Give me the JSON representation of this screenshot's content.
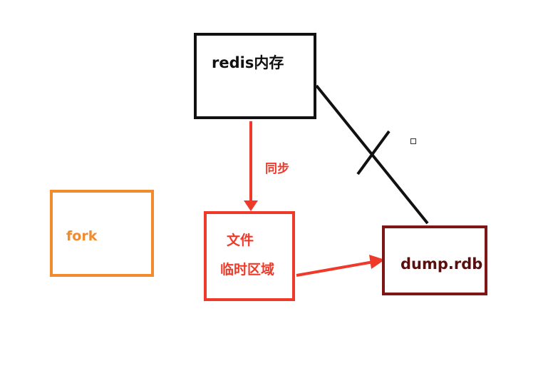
{
  "diagram": {
    "nodes": {
      "redis_memory": {
        "label": "redis内存"
      },
      "fork": {
        "label": "fork"
      },
      "temp_file": {
        "line1": "文件",
        "line2": "临时区域"
      },
      "dump": {
        "label": "dump.rdb"
      }
    },
    "edges": {
      "sync": {
        "label": "同步",
        "from": "redis_memory",
        "to": "temp_file",
        "color": "#ef3a2a"
      },
      "temp_to_dump": {
        "from": "temp_file",
        "to": "dump",
        "color": "#ef3a2a"
      },
      "redis_to_dump": {
        "from": "redis_memory",
        "to": "dump",
        "color": "#111111",
        "crossed_out": true
      }
    },
    "colors": {
      "redis": "#111111",
      "fork": "#f28a2e",
      "temp": "#ef3a2a",
      "dump": "#7e1616"
    }
  }
}
